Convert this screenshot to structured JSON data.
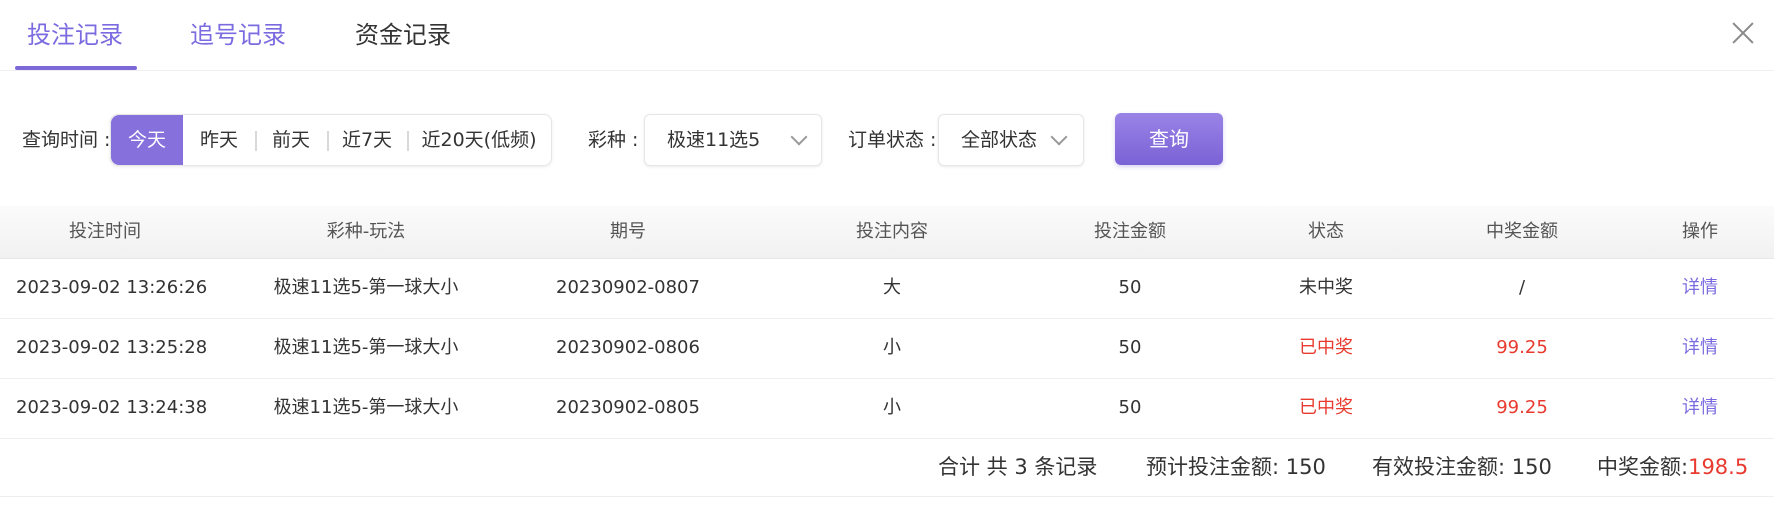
{
  "tabs": [
    {
      "label": "投注记录"
    },
    {
      "label": "追号记录"
    },
    {
      "label": "资金记录"
    }
  ],
  "filters": {
    "time_label": "查询时间 :",
    "time_options": [
      "今天",
      "昨天",
      "前天",
      "近7天",
      "近20天(低频)"
    ],
    "time_selected": "今天",
    "lottery_label": "彩种 :",
    "lottery_value": "极速11选5",
    "status_label": "订单状态 :",
    "status_value": "全部状态",
    "query_button": "查询"
  },
  "table": {
    "headers": [
      "投注时间",
      "彩种-玩法",
      "期号",
      "投注内容",
      "投注金额",
      "状态",
      "中奖金额",
      "操作"
    ],
    "rows": [
      {
        "time": "2023-09-02 13:26:26",
        "game": "极速11选5-第一球大小",
        "issue": "20230902-0807",
        "content": "大",
        "amount": "50",
        "status": "未中奖",
        "prize": "/",
        "action": "详情",
        "won": false
      },
      {
        "time": "2023-09-02 13:25:28",
        "game": "极速11选5-第一球大小",
        "issue": "20230902-0806",
        "content": "小",
        "amount": "50",
        "status": "已中奖",
        "prize": "99.25",
        "action": "详情",
        "won": true
      },
      {
        "time": "2023-09-02 13:24:38",
        "game": "极速11选5-第一球大小",
        "issue": "20230902-0805",
        "content": "小",
        "amount": "50",
        "status": "已中奖",
        "prize": "99.25",
        "action": "详情",
        "won": true
      }
    ]
  },
  "summary": {
    "total": "合计 共 3 条记录",
    "expected_label": "预计投注金额:",
    "expected_value": "150",
    "valid_label": "有效投注金额:",
    "valid_value": "150",
    "prize_label": "中奖金额:",
    "prize_value": "198.5"
  },
  "colors": {
    "accent": "#7b6be0",
    "win": "#e83a2f"
  },
  "icons": {
    "close": "close-icon",
    "dropdown": "chevron-down-icon"
  }
}
